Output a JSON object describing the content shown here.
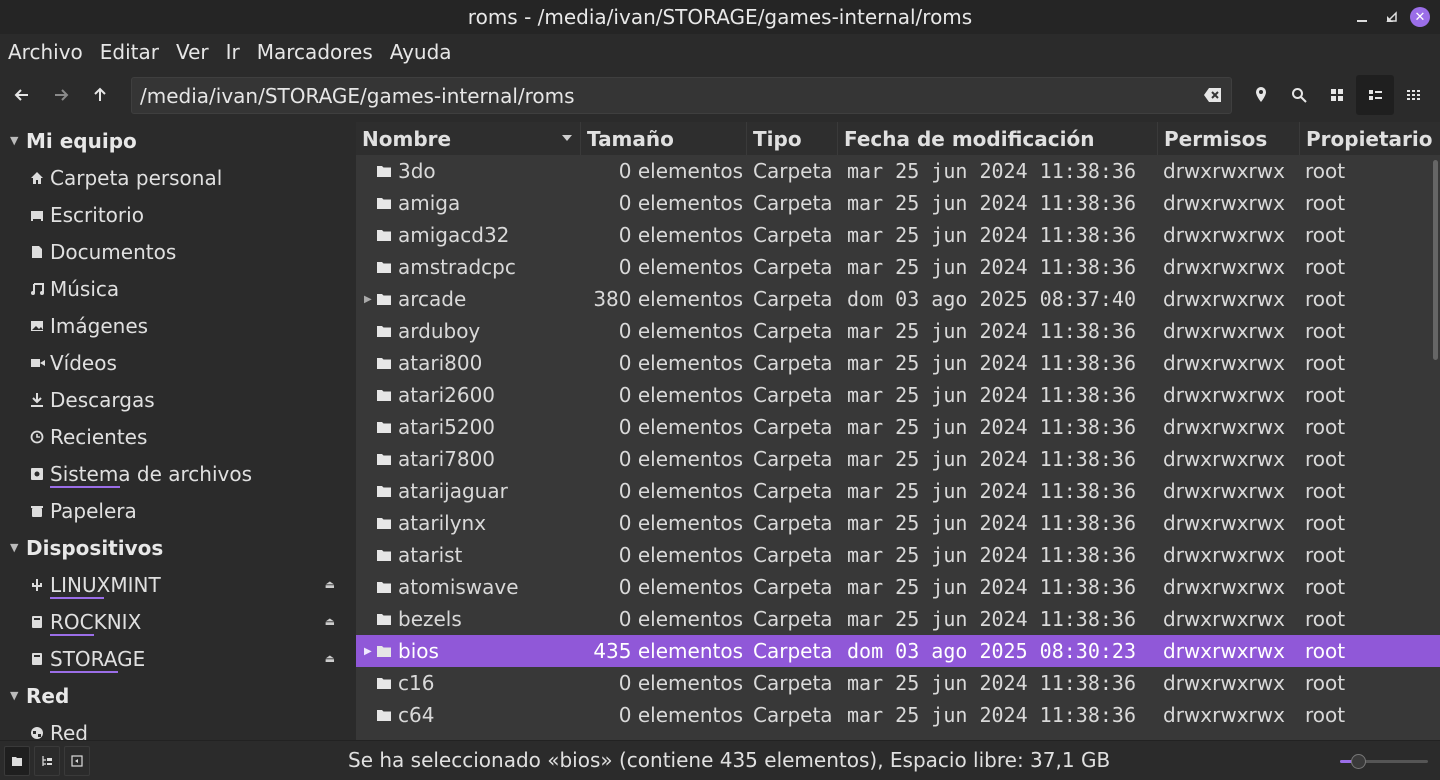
{
  "window": {
    "title": "roms - /media/ivan/STORAGE/games-internal/roms"
  },
  "menu": [
    "Archivo",
    "Editar",
    "Ver",
    "Ir",
    "Marcadores",
    "Ayuda"
  ],
  "path": {
    "value": "/media/ivan/STORAGE/games-internal/roms"
  },
  "sidebar": {
    "sections": [
      {
        "title": "Mi equipo",
        "items": [
          {
            "label": "Carpeta personal",
            "icon": "home-icon"
          },
          {
            "label": "Escritorio",
            "icon": "desktop-icon"
          },
          {
            "label": "Documentos",
            "icon": "document-icon"
          },
          {
            "label": "Música",
            "icon": "music-icon"
          },
          {
            "label": "Imágenes",
            "icon": "image-icon"
          },
          {
            "label": "Vídeos",
            "icon": "video-icon"
          },
          {
            "label": "Descargas",
            "icon": "download-icon"
          },
          {
            "label": "Recientes",
            "icon": "clock-icon"
          },
          {
            "label": "Sistema de archivos",
            "icon": "drive-icon"
          },
          {
            "label": "Papelera",
            "icon": "trash-icon"
          }
        ]
      },
      {
        "title": "Dispositivos",
        "items": [
          {
            "label": "LINUXMINT",
            "icon": "usb-icon"
          },
          {
            "label": "ROCKNIX",
            "icon": "disk-icon"
          },
          {
            "label": "STORAGE",
            "icon": "disk-icon"
          }
        ]
      },
      {
        "title": "Red",
        "items": [
          {
            "label": "Red",
            "icon": "network-icon"
          }
        ]
      }
    ]
  },
  "columns": {
    "name": "Nombre",
    "size": "Tamaño",
    "type": "Tipo",
    "date": "Fecha de modificación",
    "perm": "Permisos",
    "owner": "Propietario"
  },
  "files": [
    {
      "name": "3do",
      "size": "0 elementos",
      "type": "Carpeta",
      "date": "mar 25 jun 2024 11:38:36",
      "perm": "drwxrwxrwx",
      "owner": "root"
    },
    {
      "name": "amiga",
      "size": "0 elementos",
      "type": "Carpeta",
      "date": "mar 25 jun 2024 11:38:36",
      "perm": "drwxrwxrwx",
      "owner": "root"
    },
    {
      "name": "amigacd32",
      "size": "0 elementos",
      "type": "Carpeta",
      "date": "mar 25 jun 2024 11:38:36",
      "perm": "drwxrwxrwx",
      "owner": "root"
    },
    {
      "name": "amstradcpc",
      "size": "0 elementos",
      "type": "Carpeta",
      "date": "mar 25 jun 2024 11:38:36",
      "perm": "drwxrwxrwx",
      "owner": "root"
    },
    {
      "name": "arcade",
      "size": "380 elementos",
      "type": "Carpeta",
      "date": "dom 03 ago 2025 08:37:40",
      "perm": "drwxrwxrwx",
      "owner": "root"
    },
    {
      "name": "arduboy",
      "size": "0 elementos",
      "type": "Carpeta",
      "date": "mar 25 jun 2024 11:38:36",
      "perm": "drwxrwxrwx",
      "owner": "root"
    },
    {
      "name": "atari800",
      "size": "0 elementos",
      "type": "Carpeta",
      "date": "mar 25 jun 2024 11:38:36",
      "perm": "drwxrwxrwx",
      "owner": "root"
    },
    {
      "name": "atari2600",
      "size": "0 elementos",
      "type": "Carpeta",
      "date": "mar 25 jun 2024 11:38:36",
      "perm": "drwxrwxrwx",
      "owner": "root"
    },
    {
      "name": "atari5200",
      "size": "0 elementos",
      "type": "Carpeta",
      "date": "mar 25 jun 2024 11:38:36",
      "perm": "drwxrwxrwx",
      "owner": "root"
    },
    {
      "name": "atari7800",
      "size": "0 elementos",
      "type": "Carpeta",
      "date": "mar 25 jun 2024 11:38:36",
      "perm": "drwxrwxrwx",
      "owner": "root"
    },
    {
      "name": "atarijaguar",
      "size": "0 elementos",
      "type": "Carpeta",
      "date": "mar 25 jun 2024 11:38:36",
      "perm": "drwxrwxrwx",
      "owner": "root"
    },
    {
      "name": "atarilynx",
      "size": "0 elementos",
      "type": "Carpeta",
      "date": "mar 25 jun 2024 11:38:36",
      "perm": "drwxrwxrwx",
      "owner": "root"
    },
    {
      "name": "atarist",
      "size": "0 elementos",
      "type": "Carpeta",
      "date": "mar 25 jun 2024 11:38:36",
      "perm": "drwxrwxrwx",
      "owner": "root"
    },
    {
      "name": "atomiswave",
      "size": "0 elementos",
      "type": "Carpeta",
      "date": "mar 25 jun 2024 11:38:36",
      "perm": "drwxrwxrwx",
      "owner": "root"
    },
    {
      "name": "bezels",
      "size": "0 elementos",
      "type": "Carpeta",
      "date": "mar 25 jun 2024 11:38:36",
      "perm": "drwxrwxrwx",
      "owner": "root"
    },
    {
      "name": "bios",
      "size": "435 elementos",
      "type": "Carpeta",
      "date": "dom 03 ago 2025 08:30:23",
      "perm": "drwxrwxrwx",
      "owner": "root",
      "selected": true
    },
    {
      "name": "c16",
      "size": "0 elementos",
      "type": "Carpeta",
      "date": "mar 25 jun 2024 11:38:36",
      "perm": "drwxrwxrwx",
      "owner": "root"
    },
    {
      "name": "c64",
      "size": "0 elementos",
      "type": "Carpeta",
      "date": "mar 25 jun 2024 11:38:36",
      "perm": "drwxrwxrwx",
      "owner": "root"
    }
  ],
  "status": {
    "text": "Se ha seleccionado «bios» (contiene 435 elementos), Espacio libre: 37,1 GB",
    "zoom_level": 0.2
  },
  "colors": {
    "accent": "#9058d8",
    "close": "#9b6ee8",
    "background": "#2b2b2b",
    "list": "#383838"
  }
}
